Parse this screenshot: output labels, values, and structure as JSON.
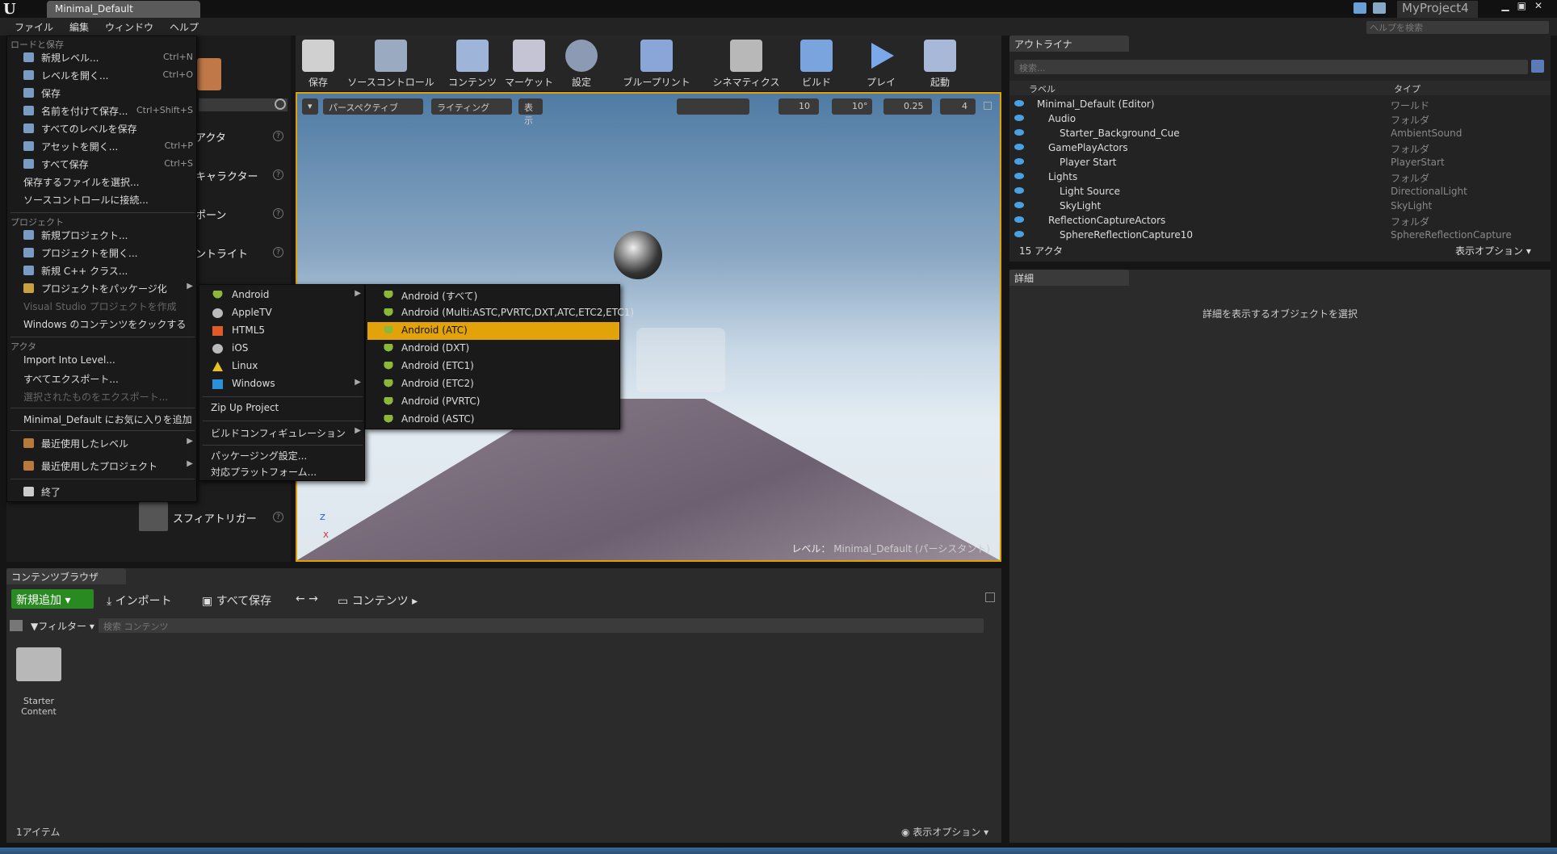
{
  "window": {
    "tab_title": "Minimal_Default",
    "project_name": "MyProject4",
    "help_placeholder": "ヘルプを検索",
    "logo_glyph": "U"
  },
  "menubar": [
    {
      "label": "ファイル"
    },
    {
      "label": "編集"
    },
    {
      "label": "ウィンドウ"
    },
    {
      "label": "ヘルプ"
    }
  ],
  "toolbar": [
    {
      "label": "保存"
    },
    {
      "label": "ソースコントロール"
    },
    {
      "label": "コンテンツ"
    },
    {
      "label": "マーケット"
    },
    {
      "label": "設定"
    },
    {
      "label": "ブループリント"
    },
    {
      "label": "シネマティクス"
    },
    {
      "label": "ビルド"
    },
    {
      "label": "プレイ"
    },
    {
      "label": "起動"
    }
  ],
  "place_panel": {
    "items": [
      {
        "label": "アクタ"
      },
      {
        "label": "キャラクター"
      },
      {
        "label": "ポーン"
      },
      {
        "label": "ントライト"
      },
      {
        "label": "スフィアトリガー"
      }
    ],
    "qmark": "?"
  },
  "viewport": {
    "perspective": "パースペクティブ",
    "lighting": "ライティング",
    "show": "表示",
    "grid_snap": "10",
    "rot_snap": "10°",
    "scale_snap": "0.25",
    "cam_speed": "4",
    "level_label": "レベル：",
    "level_name": "Minimal_Default (パーシスタント)",
    "axis_z": "Z",
    "axis_x": "X"
  },
  "outliner": {
    "tab": "アウトライナ",
    "search_placeholder": "検索...",
    "col_label": "ラベル",
    "col_type": "タイプ",
    "rows": [
      {
        "label": "Minimal_Default (Editor)",
        "type": "ワールド",
        "indent": 0
      },
      {
        "label": "Audio",
        "type": "フォルダ",
        "indent": 1
      },
      {
        "label": "Starter_Background_Cue",
        "type": "AmbientSound",
        "indent": 2
      },
      {
        "label": "GamePlayActors",
        "type": "フォルダ",
        "indent": 1
      },
      {
        "label": "Player Start",
        "type": "PlayerStart",
        "indent": 2
      },
      {
        "label": "Lights",
        "type": "フォルダ",
        "indent": 1
      },
      {
        "label": "Light Source",
        "type": "DirectionalLight",
        "indent": 2
      },
      {
        "label": "SkyLight",
        "type": "SkyLight",
        "indent": 2
      },
      {
        "label": "ReflectionCaptureActors",
        "type": "フォルダ",
        "indent": 1
      },
      {
        "label": "SphereReflectionCapture10",
        "type": "SphereReflectionCapture",
        "indent": 2
      }
    ],
    "count": "15 アクタ",
    "view_options": "表示オプション"
  },
  "details": {
    "tab": "詳細",
    "empty_msg": "詳細を表示するオブジェクトを選択"
  },
  "content_browser": {
    "tab": "コンテンツブラウザ",
    "add_new": "新規追加",
    "import": "インポート",
    "save_all": "すべて保存",
    "path": "コンテンツ",
    "filter": "フィルター",
    "search_placeholder": "検索 コンテンツ",
    "folder_label": "Starter Content",
    "item_count": "1アイテム",
    "view_options": "表示オプション"
  },
  "file_menu": {
    "sections": [
      "ロードと保存",
      "プロジェクト",
      "アクタ"
    ],
    "items": [
      {
        "label": "新規レベル...",
        "shortcut": "Ctrl+N"
      },
      {
        "label": "レベルを開く...",
        "shortcut": "Ctrl+O"
      },
      {
        "label": "保存",
        "shortcut": ""
      },
      {
        "label": "名前を付けて保存...",
        "shortcut": "Ctrl+Shift+S"
      },
      {
        "label": "すべてのレベルを保存",
        "shortcut": ""
      },
      {
        "label": "アセットを開く...",
        "shortcut": "Ctrl+P"
      },
      {
        "label": "すべて保存",
        "shortcut": "Ctrl+S"
      },
      {
        "label": "保存するファイルを選択...",
        "shortcut": ""
      },
      {
        "label": "ソースコントロールに接続...",
        "shortcut": ""
      },
      {
        "label": "新規プロジェクト...",
        "shortcut": ""
      },
      {
        "label": "プロジェクトを開く...",
        "shortcut": ""
      },
      {
        "label": "新規 C++ クラス...",
        "shortcut": ""
      },
      {
        "label": "プロジェクトをパッケージ化",
        "shortcut": ""
      },
      {
        "label": "Visual Studio プロジェクトを作成",
        "shortcut": ""
      },
      {
        "label": "Windows のコンテンツをクックする",
        "shortcut": ""
      },
      {
        "label": "Import Into Level...",
        "shortcut": ""
      },
      {
        "label": "すべてエクスポート...",
        "shortcut": ""
      },
      {
        "label": "選択されたものをエクスポート...",
        "shortcut": ""
      },
      {
        "label": "Minimal_Default にお気に入りを追加",
        "shortcut": ""
      },
      {
        "label": "最近使用したレベル",
        "shortcut": ""
      },
      {
        "label": "最近使用したプロジェクト",
        "shortcut": ""
      },
      {
        "label": "終了",
        "shortcut": ""
      }
    ]
  },
  "package_menu": {
    "items": [
      {
        "label": "Android"
      },
      {
        "label": "AppleTV"
      },
      {
        "label": "HTML5"
      },
      {
        "label": "iOS"
      },
      {
        "label": "Linux"
      },
      {
        "label": "Windows"
      },
      {
        "label": "Zip Up Project"
      },
      {
        "label": "ビルドコンフィギュレーション"
      },
      {
        "label": "パッケージング設定..."
      },
      {
        "label": "対応プラットフォーム..."
      }
    ]
  },
  "android_menu": {
    "items": [
      {
        "label": "Android (すべて)"
      },
      {
        "label": "Android (Multi:ASTC,PVRTC,DXT,ATC,ETC2,ETC1)"
      },
      {
        "label": "Android (ATC)"
      },
      {
        "label": "Android (DXT)"
      },
      {
        "label": "Android (ETC1)"
      },
      {
        "label": "Android (ETC2)"
      },
      {
        "label": "Android (PVRTC)"
      },
      {
        "label": "Android (ASTC)"
      }
    ],
    "highlight_color": "#e2a20a"
  }
}
